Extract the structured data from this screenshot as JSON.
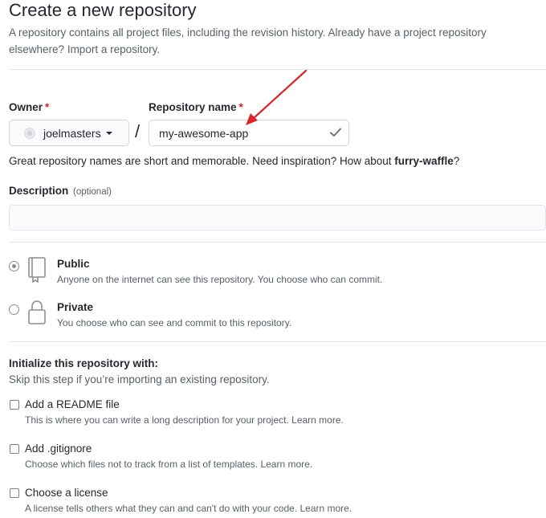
{
  "header": {
    "title": "Create a new repository",
    "subtitle": "A repository contains all project files, including the revision history. Already have a project repository elsewhere?",
    "import_link": "Import a repository."
  },
  "owner": {
    "label": "Owner",
    "required_mark": "*",
    "value": "joelmasters"
  },
  "repo": {
    "label": "Repository name",
    "required_mark": "*",
    "value": "my-awesome-app",
    "slash": "/"
  },
  "hint": {
    "text": "Great repository names are short and memorable. Need inspiration? How about",
    "suggestion": "furry-waffle",
    "end": "?"
  },
  "description": {
    "label": "Description",
    "optional": "(optional)",
    "value": ""
  },
  "visibility": {
    "public": {
      "title": "Public",
      "desc": "Anyone on the internet can see this repository. You choose who can commit.",
      "checked": true
    },
    "private": {
      "title": "Private",
      "desc": "You choose who can see and commit to this repository.",
      "checked": false
    }
  },
  "init": {
    "title": "Initialize this repository with:",
    "subtitle": "Skip this step if you’re importing an existing repository.",
    "options": [
      {
        "title": "Add a README file",
        "desc": "This is where you can write a long description for your project. Learn more.",
        "checked": false
      },
      {
        "title": "Add .gitignore",
        "desc": "Choose which files not to track from a list of templates. Learn more.",
        "checked": false
      },
      {
        "title": "Choose a license",
        "desc": "A license tells others what they can and can't do with your code. Learn more.",
        "checked": false
      }
    ]
  },
  "colors": {
    "required": "#cb2431",
    "arrow": "#d8262c",
    "muted_text": "#586069"
  }
}
